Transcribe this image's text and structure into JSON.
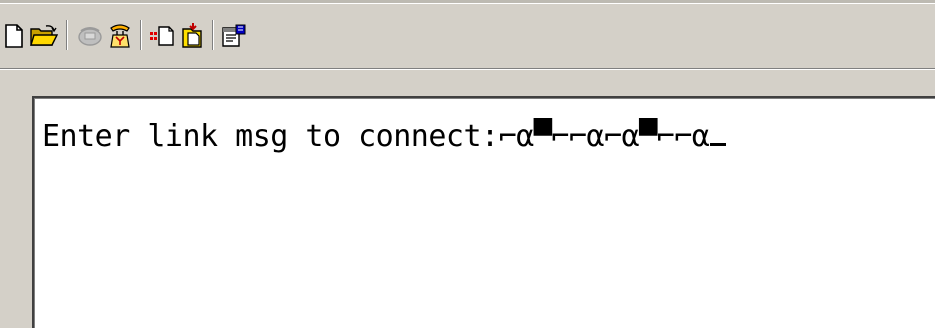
{
  "toolbar": {
    "buttons": [
      {
        "name": "new-icon"
      },
      {
        "name": "open-icon"
      },
      {
        "name": "connect-icon"
      },
      {
        "name": "disconnect-icon"
      },
      {
        "name": "send-icon"
      },
      {
        "name": "receive-icon"
      },
      {
        "name": "properties-icon"
      }
    ]
  },
  "terminal": {
    "line1": "Enter link msg to connect:⌐α▀⌐⌐α⌐α▀⌐⌐α"
  },
  "colors": {
    "background": "#d4d0c8",
    "terminal_bg": "#ffffff",
    "text": "#000000"
  }
}
